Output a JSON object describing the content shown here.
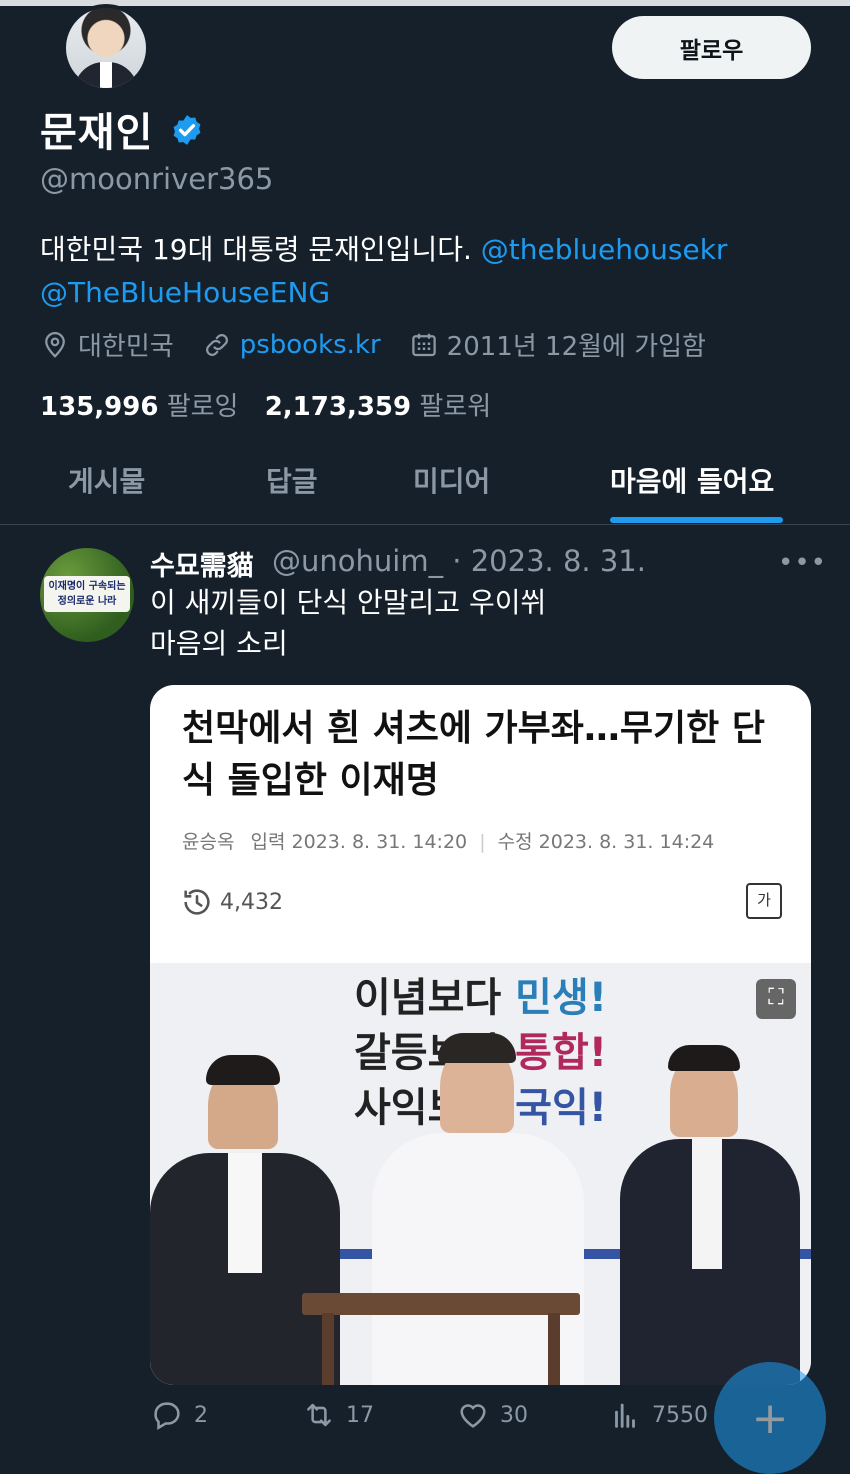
{
  "profile": {
    "name": "문재인",
    "handle": "@moonriver365",
    "follow_label": "팔로우",
    "bio_text": "대한민국 19대 대통령 문재인입니다. ",
    "bio_link1": "@thebluehousekr",
    "bio_link2": "@TheBlueHouseENG",
    "location": "대한민국",
    "website": "psbooks.kr",
    "joined": "2011년 12월에 가입함",
    "following_count": "135,996",
    "following_label": "팔로잉",
    "followers_count": "2,173,359",
    "followers_label": "팔로워"
  },
  "tabs": [
    {
      "label": "게시물"
    },
    {
      "label": "답글"
    },
    {
      "label": "미디어"
    },
    {
      "label": "마음에 들어요"
    }
  ],
  "tweet": {
    "author": "수묘需貓",
    "handle_date": "@unohuim_ · 2023. 8. 31.",
    "line1": "이 새끼들이 단식 안말리고 우이쒸",
    "line2": "마음의 소리",
    "avatar_text": "이재명이 구속되는 정의로운 나라",
    "card": {
      "headline": "천막에서 흰 셔츠에 가부좌…무기한 단식 돌입한 이재명",
      "reporter": "윤승옥",
      "input_label": "입력",
      "input_date": "2023. 8. 31. 14:20",
      "edit_label": "수정",
      "edit_date": "2023. 8. 31. 14:24",
      "views": "4,432",
      "font_ctrl": "가",
      "slogan1a": "이념보다 ",
      "slogan1b": "민생!",
      "slogan2a": "갈등보다 ",
      "slogan2b": "통합!",
      "slogan3a": "사익보다 ",
      "slogan3b": "국익!"
    },
    "actions": {
      "replies": "2",
      "retweets": "17",
      "likes": "30",
      "views": "7550"
    }
  },
  "colors": {
    "background": "#15202b",
    "accent": "#1d9bf0",
    "muted": "#8b98a5"
  }
}
